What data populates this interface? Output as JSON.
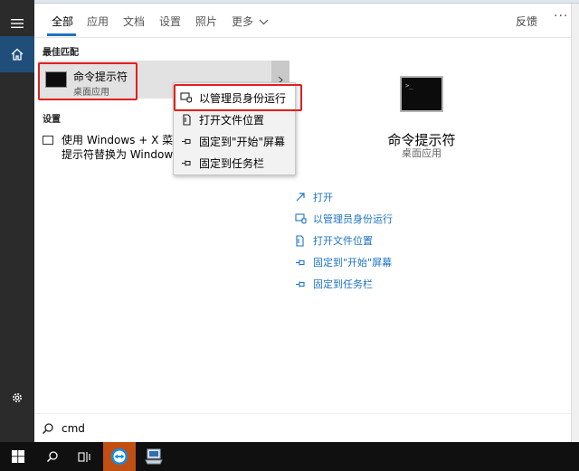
{
  "tabs": [
    "全部",
    "应用",
    "文档",
    "设置",
    "照片",
    "更多"
  ],
  "feedback_label": "反馈",
  "more_menu": "···",
  "best_match": {
    "section": "最佳匹配",
    "app_name": "命令提示符",
    "app_type": "桌面应用"
  },
  "settings": {
    "section": "设置",
    "line1": "使用 Windows + X 菜单",
    "line2": "提示符替换为 Windows"
  },
  "context_menu": [
    {
      "label": "以管理员身份运行",
      "icon": "shield-run-icon"
    },
    {
      "label": "打开文件位置",
      "icon": "file-location-icon"
    },
    {
      "label": "固定到\"开始\"屏幕",
      "icon": "pin-icon"
    },
    {
      "label": "固定到任务栏",
      "icon": "pin-icon"
    }
  ],
  "preview": {
    "title": "命令提示符",
    "subtitle": "桌面应用",
    "actions": [
      {
        "label": "打开",
        "icon": "open-icon"
      },
      {
        "label": "以管理员身份运行",
        "icon": "shield-run-icon"
      },
      {
        "label": "打开文件位置",
        "icon": "file-location-icon"
      },
      {
        "label": "固定到\"开始\"屏幕",
        "icon": "pin-icon"
      },
      {
        "label": "固定到任务栏",
        "icon": "pin-icon"
      }
    ]
  },
  "search": {
    "query": "cmd"
  },
  "colors": {
    "accent": "#1e73c2",
    "highlight_border": "#e0201d",
    "rail": "#2b2b2b",
    "taskbar": "#101010"
  }
}
